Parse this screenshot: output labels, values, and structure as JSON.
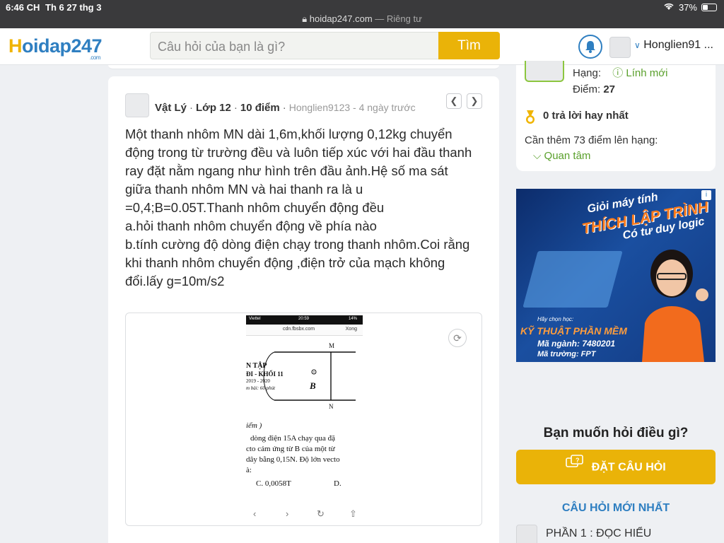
{
  "status_bar": {
    "time": "6:46 CH",
    "date": "Th 6 27 thg 3",
    "url": "hoidap247.com",
    "url_suffix": "— Riêng tư",
    "battery": "37%"
  },
  "header": {
    "logo_first": "H",
    "logo_rest": "oidap247",
    "logo_suffix": ".com",
    "search_placeholder": "Câu hỏi của bạn là gì?",
    "search_button": "Tìm",
    "username": "Honglien91 ..."
  },
  "question": {
    "subject": "Vật Lý",
    "grade": "Lớp 12",
    "points": "10 điểm",
    "author_time": "Honglien9123 - 4 ngày trước",
    "lines": [
      "Một thanh nhôm MN dài 1,6m,khối lượng 0,12kg chuyển",
      "động trong từ trường đều và luôn tiếp xúc với hai đầu thanh",
      "ray đặt nằm ngang như hình trên đầu ảnh.Hệ số ma sát",
      "giữa thanh nhôm MN và hai thanh ra là u",
      "=0,4;B=0.05T.Thanh nhôm chuyển động đều",
      "a.hỏi thanh nhôm chuyển động về phía nào",
      "b.tính cường độ dòng điện chạy trong thanh nhôm.Coi rằng",
      "khi thanh nhôm chuyển động ,điện trở của mạch không",
      "đổi.lấy g=10m/s2"
    ],
    "image": {
      "carrier": "Viettel",
      "phone_time": "20:59",
      "phone_battery": "14%",
      "address": "cdn.fbsbx.com",
      "done": "Xong",
      "label_m": "M",
      "label_n": "N",
      "label_b": "B",
      "doc_lines": [
        "N TẬP",
        "ĐI - KHỐI 11",
        "2019 - 2020",
        "m bài: 60 phút"
      ],
      "text_lines": [
        "iểm )",
        "dòng điện 15A chạy qua đặ",
        "cto cảm ứng từ B của một từ",
        "dây bằng 0,15N. Độ lớn vecto",
        "à:"
      ],
      "answer_c": "C.   0,0058T",
      "answer_d": "D."
    }
  },
  "sidebar": {
    "rank_label": "Hạng:",
    "rank_value": "Lính mới",
    "points_label": "Điểm:",
    "points_value": "27",
    "best_answers": "0 trả lời hay nhất",
    "need_more": "Cần thêm 73 điểm lên hạng:",
    "follow": "Quan tâm"
  },
  "ad": {
    "line1": "Giỏi máy tính",
    "line2": "THÍCH LẬP TRÌNH",
    "line3": "Có tư duy logic",
    "choose": "Hãy chọn học:",
    "major": "KỸ THUẬT PHẦN MỀM",
    "code": "Mã ngành: 7480201",
    "school": "Mã trường: FPT"
  },
  "ask": {
    "title": "Bạn muốn hỏi điều gì?",
    "button": "ĐẶT CÂU HỎI"
  },
  "newest": {
    "title": "CÂU HỎI MỚI NHẤT",
    "first_item": "PHẦN 1 : ĐỌC HIỂU"
  }
}
